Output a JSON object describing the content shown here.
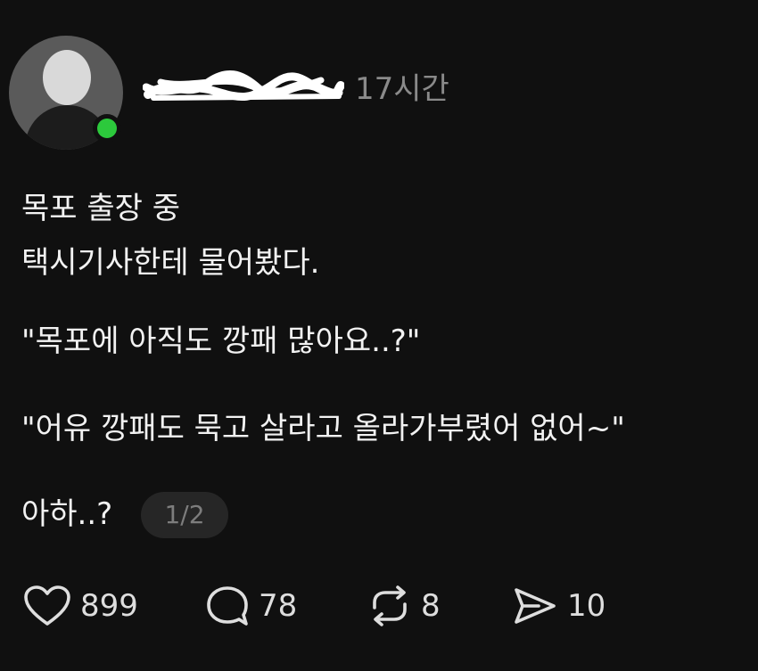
{
  "post": {
    "author": {
      "username": "",
      "online": true
    },
    "timestamp": "17시간",
    "body_lines": [
      "목포 출장 중",
      "택시기사한테 물어봤다.",
      "\"목포에 아직도 깡패 많아요..?\"",
      "\"어유 깡패도 묵고 살라고 올라가부렸어 없어~\"",
      "아하..?"
    ],
    "page_indicator": "1/2",
    "actions": {
      "like": {
        "icon": "heart-icon",
        "count": "899"
      },
      "comment": {
        "icon": "comment-bubble-icon",
        "count": "78"
      },
      "repost": {
        "icon": "repost-icon",
        "count": "8"
      },
      "share": {
        "icon": "send-icon",
        "count": "10"
      }
    },
    "colors": {
      "background": "#101010",
      "text": "#f2f2f2",
      "muted": "#8a8a8a",
      "online": "#2cc93c",
      "badge_bg": "#262626"
    }
  }
}
